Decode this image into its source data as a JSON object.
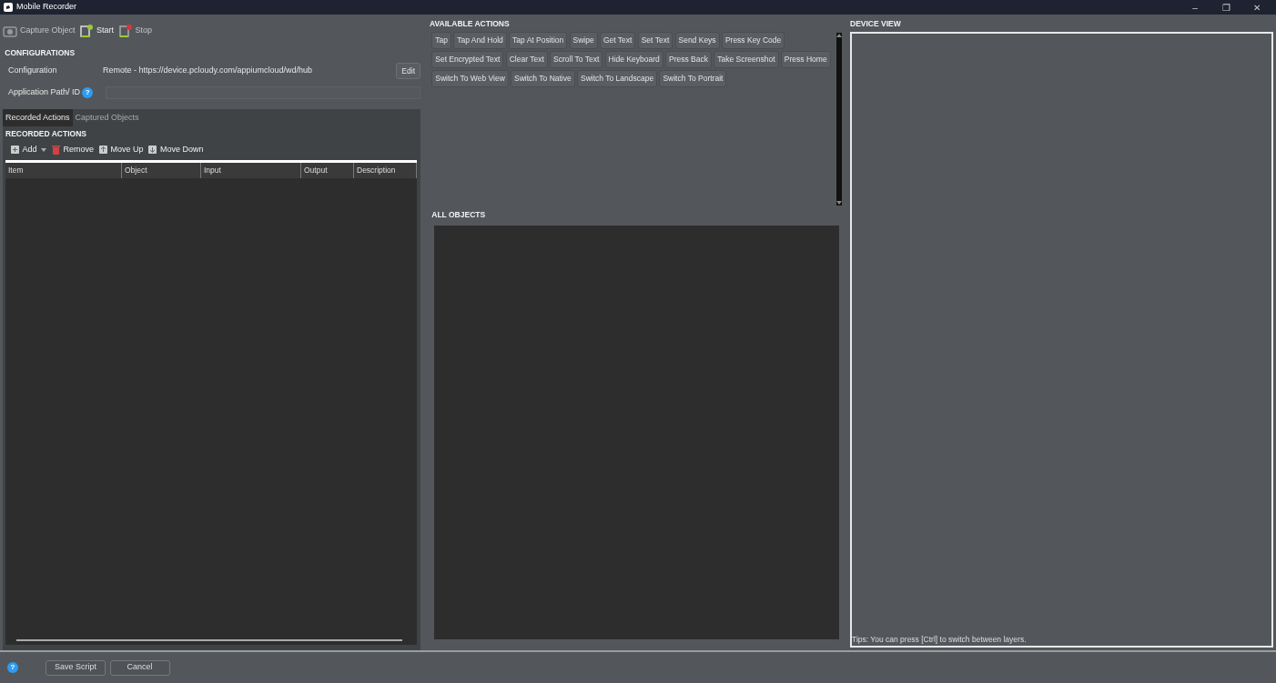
{
  "window": {
    "title": "Mobile Recorder",
    "controls": [
      "–",
      "❐",
      "✕"
    ]
  },
  "toolbar": [
    {
      "label": "Capture Object",
      "kind": "capture",
      "disabled": true
    },
    {
      "label": "Start",
      "kind": "start",
      "disabled": false
    },
    {
      "label": "Stop",
      "kind": "stop",
      "disabled": true
    }
  ],
  "configurations": {
    "heading": "CONFIGURATIONS",
    "configuration_label": "Configuration",
    "configuration_value": "Remote - https://device.pcloudy.com/appiumcloud/wd/hub",
    "edit_button": "Edit",
    "app_path_label": "Application Path/ ID",
    "help": "?"
  },
  "tabs": [
    {
      "label": "Recorded Actions",
      "selected": true
    },
    {
      "label": "Captured Objects",
      "selected": false
    }
  ],
  "recorded_actions": {
    "heading": "RECORDED ACTIONS",
    "tools": [
      {
        "label": "Add",
        "kind": "add"
      },
      {
        "label": "Remove",
        "kind": "remove"
      },
      {
        "label": "Move Up",
        "kind": "up"
      },
      {
        "label": "Move Down",
        "kind": "down"
      }
    ],
    "columns": [
      "Item",
      "Object",
      "Input",
      "Output",
      "Description"
    ]
  },
  "available_actions": {
    "heading": "AVAILABLE ACTIONS",
    "actions": [
      "Tap",
      "Tap And Hold",
      "Tap At Position",
      "Swipe",
      "Get Text",
      "Set Text",
      "Send Keys",
      "Press Key Code",
      "Set Encrypted Text",
      "Clear Text",
      "Scroll To Text",
      "Hide Keyboard",
      "Press Back",
      "Take Screenshot",
      "Press Home",
      "Switch To Web View",
      "Switch To Native",
      "Switch To Landscape",
      "Switch To Portrait"
    ]
  },
  "all_objects": {
    "heading": "ALL OBJECTS"
  },
  "device_view": {
    "heading": "DEVICE VIEW",
    "tip": "Tips: You can press [Ctrl] to switch between layers."
  },
  "footer": {
    "help": "?",
    "buttons": [
      "Save Script",
      "Cancel"
    ]
  }
}
